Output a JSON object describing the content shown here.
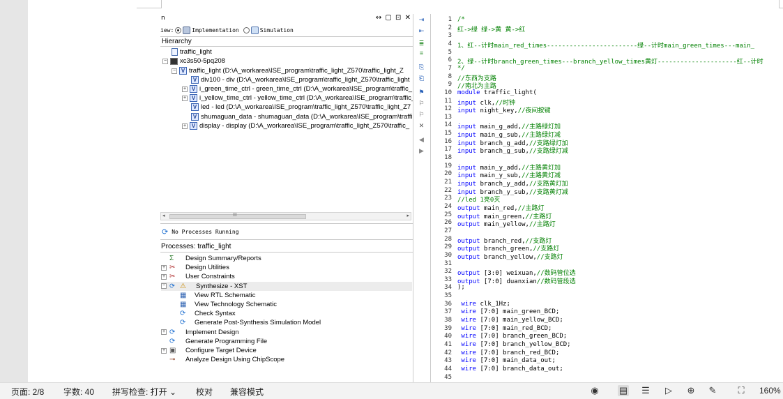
{
  "ise": {
    "panel_title": "n",
    "panel_controls": "↔ ▢ ⊡ ✕",
    "view_label": "iew:",
    "impl_label": "Implementation",
    "sim_label": "Simulation",
    "hierarchy_label": "Hierarchy",
    "tree": [
      {
        "text": "traffic_light",
        "indent": 0,
        "icon": "file-icon",
        "pm": ""
      },
      {
        "text": "xc3s50-5pq208",
        "indent": 0,
        "icon": "chip-icon",
        "pm": "−"
      },
      {
        "text": "traffic_light (D:\\A_workarea\\ISE_program\\traffic_light_Z570\\traffic_light_Z",
        "indent": 1,
        "icon": "verilog-top-icon",
        "pm": "−"
      },
      {
        "text": "div100 - div (D:\\A_workarea\\ISE_program\\traffic_light_Z570\\traffic_light",
        "indent": 2,
        "icon": "verilog-icon",
        "pm": ""
      },
      {
        "text": "i_green_time_ctrl - green_time_ctrl (D:\\A_workarea\\ISE_program\\traffic_",
        "indent": 2,
        "icon": "verilog-icon",
        "pm": "+"
      },
      {
        "text": "i_yellow_time_ctrl - yellow_time_ctrl (D:\\A_workarea\\ISE_program\\traffic_",
        "indent": 2,
        "icon": "verilog-icon",
        "pm": "+"
      },
      {
        "text": "led - led (D:\\A_workarea\\ISE_program\\traffic_light_Z570\\traffic_light_Z7",
        "indent": 2,
        "icon": "verilog-icon",
        "pm": ""
      },
      {
        "text": "shumaguan_data - shumaguan_data (D:\\A_workarea\\ISE_program\\traffi",
        "indent": 2,
        "icon": "verilog-icon",
        "pm": ""
      },
      {
        "text": "display - display (D:\\A_workarea\\ISE_program\\traffic_light_Z570\\traffic_",
        "indent": 2,
        "icon": "verilog-icon",
        "pm": "+"
      }
    ],
    "scroll_thumb_label": "III",
    "no_process_label": "No Processes Running",
    "processes_label": "Processes: traffic_light",
    "processes": [
      {
        "text": "Design Summary/Reports",
        "indent": 0,
        "pm": "",
        "icon": "sigma-icon"
      },
      {
        "text": "Design Utilities",
        "indent": 0,
        "pm": "+",
        "icon": "tools-icon"
      },
      {
        "text": "User Constraints",
        "indent": 0,
        "pm": "+",
        "icon": "tools-icon"
      },
      {
        "text": "Synthesize - XST",
        "indent": 0,
        "pm": "−",
        "icon": "warning-icon",
        "highlight": true
      },
      {
        "text": "View RTL Schematic",
        "indent": 1,
        "pm": "",
        "icon": "schematic-icon"
      },
      {
        "text": "View Technology Schematic",
        "indent": 1,
        "pm": "",
        "icon": "schematic-icon"
      },
      {
        "text": "Check Syntax",
        "indent": 1,
        "pm": "",
        "icon": "run-icon"
      },
      {
        "text": "Generate Post-Synthesis Simulation Model",
        "indent": 1,
        "pm": "",
        "icon": "run-icon"
      },
      {
        "text": "Implement Design",
        "indent": 0,
        "pm": "+",
        "icon": "run-icon"
      },
      {
        "text": "Generate Programming File",
        "indent": 0,
        "pm": "",
        "icon": "run-icon"
      },
      {
        "text": "Configure Target Device",
        "indent": 0,
        "pm": "+",
        "icon": "device-icon"
      },
      {
        "text": "Analyze Design Using ChipScope",
        "indent": 0,
        "pm": "",
        "icon": "chipscope-icon"
      }
    ],
    "code": [
      {
        "n": "1",
        "t": "/*",
        "c": "cm"
      },
      {
        "n": "2",
        "t": "红->绿 绿->黄 黄->红",
        "c": "cm"
      },
      {
        "n": "3",
        "t": "",
        "c": ""
      },
      {
        "n": "4",
        "t": "1、红--计时main_red_times------------------------绿--计时main_green_times---main_",
        "c": "cm"
      },
      {
        "n": "5",
        "t": "",
        "c": ""
      },
      {
        "n": "6",
        "t": "2、绿--计时branch_green_times---branch_yellow_times黄灯---------------------红--计时",
        "c": "cm"
      },
      {
        "n": "7",
        "t": "*/",
        "c": "cm"
      },
      {
        "n": "8",
        "t": "//东西为支路",
        "c": "cm"
      },
      {
        "n": "9",
        "t": "//南北为主路",
        "c": "cm"
      },
      {
        "n": "10",
        "t": "module traffic_light(",
        "c": "mod"
      },
      {
        "n": "11",
        "t": "input clk,//时钟",
        "c": "in"
      },
      {
        "n": "12",
        "t": "input night_key,//夜间按键",
        "c": "in"
      },
      {
        "n": "13",
        "t": "",
        "c": ""
      },
      {
        "n": "14",
        "t": "input main_g_add,//主路绿灯加",
        "c": "in"
      },
      {
        "n": "15",
        "t": "input main_g_sub,//主路绿灯减",
        "c": "in"
      },
      {
        "n": "16",
        "t": "input branch_g_add,//支路绿灯加",
        "c": "in"
      },
      {
        "n": "17",
        "t": "input branch_g_sub,//支路绿灯减",
        "c": "in"
      },
      {
        "n": "18",
        "t": "",
        "c": ""
      },
      {
        "n": "19",
        "t": "input main_y_add,//主路黄灯加",
        "c": "in"
      },
      {
        "n": "20",
        "t": "input main_y_sub,//主路黄灯减",
        "c": "in"
      },
      {
        "n": "21",
        "t": "input branch_y_add,//支路黄灯加",
        "c": "in"
      },
      {
        "n": "22",
        "t": "input branch_y_sub,//支路黄灯减",
        "c": "in"
      },
      {
        "n": "23",
        "t": "//led 1亮0灭",
        "c": "cm"
      },
      {
        "n": "24",
        "t": "output main_red,//主路灯",
        "c": "out"
      },
      {
        "n": "25",
        "t": "output main_green,//主路灯",
        "c": "out"
      },
      {
        "n": "26",
        "t": "output main_yellow,//主路灯",
        "c": "out"
      },
      {
        "n": "27",
        "t": "",
        "c": ""
      },
      {
        "n": "28",
        "t": "output branch_red,//支路灯",
        "c": "out"
      },
      {
        "n": "29",
        "t": "output branch_green,//支路灯",
        "c": "out"
      },
      {
        "n": "30",
        "t": "output branch_yellow,//支路灯",
        "c": "out"
      },
      {
        "n": "31",
        "t": "",
        "c": ""
      },
      {
        "n": "32",
        "t": "output [3:0] weixuan,//数码管位选",
        "c": "out"
      },
      {
        "n": "33",
        "t": "output [7:0] duanxian//数码管段选",
        "c": "out"
      },
      {
        "n": "34",
        "t": ");",
        "c": ""
      },
      {
        "n": "35",
        "t": "",
        "c": ""
      },
      {
        "n": "36",
        "t": " wire clk_1Hz;",
        "c": "wire"
      },
      {
        "n": "37",
        "t": " wire [7:0] main_green_BCD;",
        "c": "wire"
      },
      {
        "n": "38",
        "t": " wire [7:0] main_yellow_BCD;",
        "c": "wire"
      },
      {
        "n": "39",
        "t": " wire [7:0] main_red_BCD;",
        "c": "wire"
      },
      {
        "n": "40",
        "t": " wire [7:0] branch_green_BCD;",
        "c": "wire"
      },
      {
        "n": "41",
        "t": " wire [7:0] branch_yellow_BCD;",
        "c": "wire"
      },
      {
        "n": "42",
        "t": " wire [7:0] branch_red_BCD;",
        "c": "wire"
      },
      {
        "n": "43",
        "t": " wire [7:0] main_data_out;",
        "c": "wire"
      },
      {
        "n": "44",
        "t": " wire [7:0] branch_data_out;",
        "c": "wire"
      },
      {
        "n": "45",
        "t": "",
        "c": ""
      }
    ]
  },
  "statusbar": {
    "page": "页面: 2/8",
    "words": "字数: 40",
    "spellcheck": "拼写检查: 打开 ⌄",
    "proofread": "校对",
    "compat": "兼容模式",
    "zoom": "160%"
  }
}
